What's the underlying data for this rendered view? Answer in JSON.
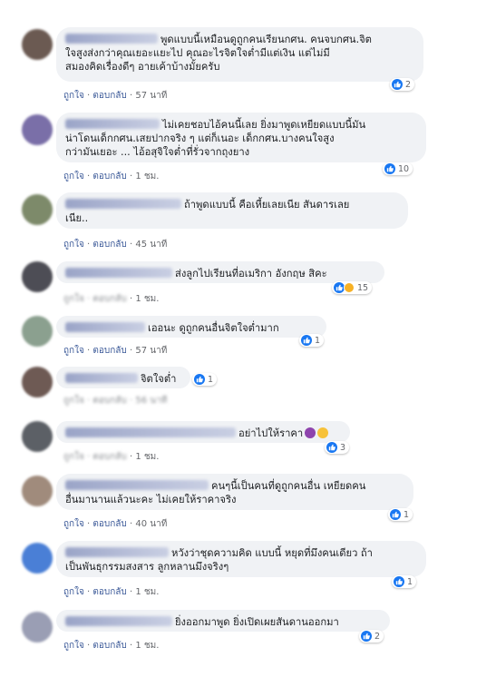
{
  "actions": {
    "like": "ถูกใจ",
    "reply": "ตอบกลับ",
    "sep": " · "
  },
  "comments": [
    {
      "text": "พูดแบบนี้เหมือนดูถูกคนเรียนกศน. คนจบกศน.จิต\nใจสูงส่งกว่าคุณเยอะแยะไป คุณอะไรจิตใจต่ำมีแต่เงิน แต่ไม่มี\nสมองคิดเรื่องดีๆ อายเค้าบ้างมั้ยครับ",
      "time": "57 นาที",
      "reactions": "2",
      "avatar_color": "#6b5a52"
    },
    {
      "text": "ไม่เคยชอบไอ้คนนี้เลย ยิ่งมาพูดเหยียดแบบนี้มัน\nน่าโดนเด็กกศน.เสยปากจริง ๆ แต่ก็เนอะ เด็กกศน.บางคนใจสูง\nกว่ามันเยอะ ... ไอ้อสุจิใจต่ำที่รั่วจากถุงยาง",
      "time": "1 ชม.",
      "reactions": "10",
      "avatar_color": "#7a6fa8"
    },
    {
      "text": "ถ้าพูดแบบนี้ คือเหี้ยเลยเนีย สันดารเลย\nเนีย..",
      "time": "45 นาที",
      "reactions": "",
      "avatar_color": "#7d8a6a"
    },
    {
      "text": "ส่งลูกไปเรียนที่อเมริกา อังกฤษ สิคะ",
      "time": "1 ชม.",
      "reactions": "15",
      "avatar_color": "#4d4d55"
    },
    {
      "text": "เออนะ ดูถูกคนอื่นจิตใจต่ำมาก",
      "time": "57 นาที",
      "reactions": "1",
      "avatar_color": "#8ba08f"
    },
    {
      "text": "จิตใจต่ำ",
      "time": "56 นาที",
      "reactions": "1",
      "avatar_color": "#6e5a54"
    },
    {
      "text": "อย่าไปให้ราคา",
      "time": "1 ชม.",
      "reactions": "3",
      "avatar_color": "#5c6066"
    },
    {
      "text": "คนๆนี้เป็นคนที่ดูถูกคนอื่น เหยียดคน\nอื่นมานานแล้วนะคะ ไม่เคยให้ราคาจริง",
      "time": "40 นาที",
      "reactions": "1",
      "avatar_color": "#a08b7c"
    },
    {
      "text": "หวังว่าชุดความคิด แบบนี้ หยุดที่มึงคนเดียว ถ้า\nเป็นพันธุกรรมสงสาร ลูกหลานมึงจริงๆ",
      "time": "1 ชม.",
      "reactions": "1",
      "avatar_color": "#4a7fd6"
    },
    {
      "text": "ยิ่งออกมาพูด ยิ่งเปิดเผยสันดานออกมา",
      "time": "1 ชม.",
      "reactions": "2",
      "avatar_color": "#9a9eb4"
    }
  ]
}
